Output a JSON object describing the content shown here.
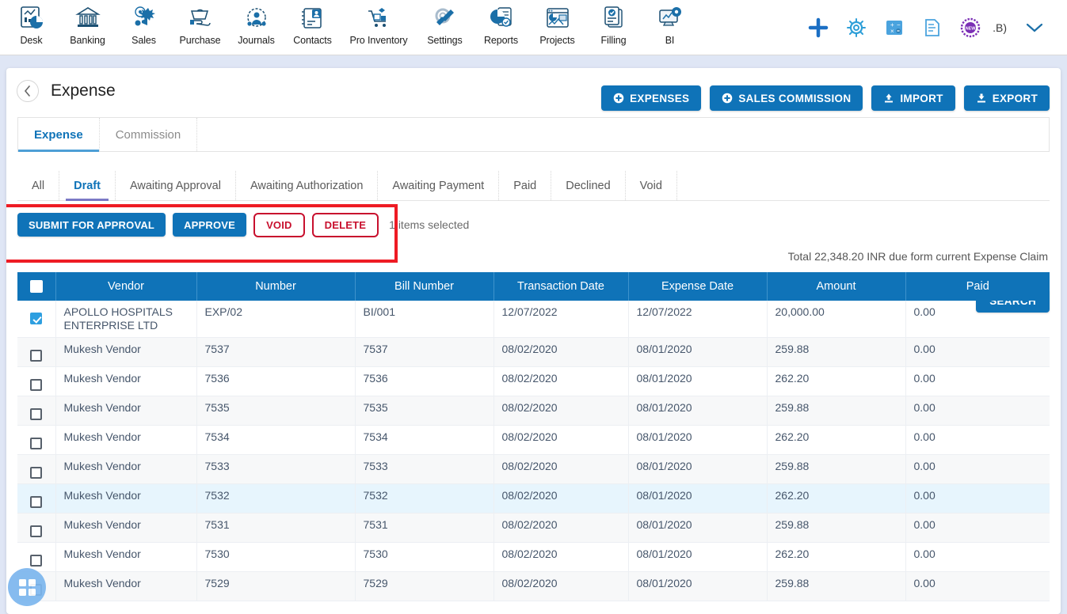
{
  "topnav": {
    "items": [
      {
        "label": "Desk",
        "icon": "desk-dashboard-icon"
      },
      {
        "label": "Banking",
        "icon": "bank-icon"
      },
      {
        "label": "Sales",
        "icon": "sales-icon"
      },
      {
        "label": "Purchase",
        "icon": "purchase-icon"
      },
      {
        "label": "Journals",
        "icon": "journals-icon"
      },
      {
        "label": "Contacts",
        "icon": "contacts-icon"
      },
      {
        "label": "Pro Inventory",
        "icon": "inventory-icon"
      },
      {
        "label": "Settings",
        "icon": "settings-tools-icon"
      },
      {
        "label": "Reports",
        "icon": "reports-piechart-icon"
      },
      {
        "label": "Projects",
        "icon": "projects-icon"
      },
      {
        "label": "Filling",
        "icon": "filling-icon"
      },
      {
        "label": "BI",
        "icon": "bi-monitor-icon"
      }
    ],
    "right_icons": [
      {
        "name": "add-plus-icon",
        "color": "#1b6fc4"
      },
      {
        "name": "gear-icon",
        "color": "#2e9fd8"
      },
      {
        "name": "calculator-icon",
        "color": "#4aa3de"
      },
      {
        "name": "document-icon",
        "color": "#4aa3de"
      },
      {
        "name": "new-badge-icon",
        "color": "#7b2fb5",
        "text": "NEW"
      }
    ],
    "user_code": ".B)",
    "chevron": "chevron-down-icon"
  },
  "header": {
    "back": "back-chevron-icon",
    "title": "Expense",
    "actions": [
      {
        "label": "EXPENSES",
        "icon": "plus-circle-icon"
      },
      {
        "label": "SALES COMMISSION",
        "icon": "plus-circle-icon"
      },
      {
        "label": "IMPORT",
        "icon": "upload-icon"
      },
      {
        "label": "EXPORT",
        "icon": "download-icon"
      }
    ]
  },
  "main_tabs": [
    {
      "label": "Expense",
      "active": true
    },
    {
      "label": "Commission",
      "active": false
    }
  ],
  "filter_tabs": [
    {
      "label": "All",
      "active": false
    },
    {
      "label": "Draft",
      "active": true
    },
    {
      "label": "Awaiting Approval",
      "active": false
    },
    {
      "label": "Awaiting Authorization",
      "active": false
    },
    {
      "label": "Awaiting Payment",
      "active": false
    },
    {
      "label": "Paid",
      "active": false
    },
    {
      "label": "Declined",
      "active": false
    },
    {
      "label": "Void",
      "active": false
    }
  ],
  "actions": {
    "submit_label": "SUBMIT FOR APPROVAL",
    "approve_label": "APPROVE",
    "void_label": "VOID",
    "delete_label": "DELETE",
    "selected_text": "1 items selected",
    "search_label": "SEARCH",
    "total_note": "Total 22,348.20 INR due form current Expense Claim"
  },
  "table": {
    "columns": [
      "",
      "Vendor",
      "Number",
      "Bill Number",
      "Transaction Date",
      "Expense Date",
      "Amount",
      "Paid"
    ],
    "header_checkbox_checked": false,
    "rows": [
      {
        "checked": true,
        "stripe": "plain",
        "vendor": "APOLLO HOSPITALS ENTERPRISE LTD",
        "number": "EXP/02",
        "bill": "BI/001",
        "txn_date": "12/07/2022",
        "exp_date": "12/07/2022",
        "amount": "20,000.00",
        "paid": "0.00"
      },
      {
        "checked": false,
        "stripe": "alt",
        "vendor": "Mukesh Vendor",
        "number": "7537",
        "bill": "7537",
        "txn_date": "08/02/2020",
        "exp_date": "08/01/2020",
        "amount": "259.88",
        "paid": "0.00"
      },
      {
        "checked": false,
        "stripe": "plain",
        "vendor": "Mukesh Vendor",
        "number": "7536",
        "bill": "7536",
        "txn_date": "08/02/2020",
        "exp_date": "08/01/2020",
        "amount": "262.20",
        "paid": "0.00"
      },
      {
        "checked": false,
        "stripe": "alt",
        "vendor": "Mukesh Vendor",
        "number": "7535",
        "bill": "7535",
        "txn_date": "08/02/2020",
        "exp_date": "08/01/2020",
        "amount": "259.88",
        "paid": "0.00"
      },
      {
        "checked": false,
        "stripe": "plain",
        "vendor": "Mukesh Vendor",
        "number": "7534",
        "bill": "7534",
        "txn_date": "08/02/2020",
        "exp_date": "08/01/2020",
        "amount": "262.20",
        "paid": "0.00"
      },
      {
        "checked": false,
        "stripe": "alt",
        "vendor": "Mukesh Vendor",
        "number": "7533",
        "bill": "7533",
        "txn_date": "08/02/2020",
        "exp_date": "08/01/2020",
        "amount": "259.88",
        "paid": "0.00"
      },
      {
        "checked": false,
        "stripe": "hl",
        "vendor": "Mukesh Vendor",
        "number": "7532",
        "bill": "7532",
        "txn_date": "08/02/2020",
        "exp_date": "08/01/2020",
        "amount": "262.20",
        "paid": "0.00"
      },
      {
        "checked": false,
        "stripe": "alt",
        "vendor": "Mukesh Vendor",
        "number": "7531",
        "bill": "7531",
        "txn_date": "08/02/2020",
        "exp_date": "08/01/2020",
        "amount": "259.88",
        "paid": "0.00"
      },
      {
        "checked": false,
        "stripe": "plain",
        "vendor": "Mukesh Vendor",
        "number": "7530",
        "bill": "7530",
        "txn_date": "08/02/2020",
        "exp_date": "08/01/2020",
        "amount": "262.20",
        "paid": "0.00"
      },
      {
        "checked": false,
        "stripe": "alt",
        "vendor": "Mukesh Vendor",
        "number": "7529",
        "bill": "7529",
        "txn_date": "08/02/2020",
        "exp_date": "08/01/2020",
        "amount": "259.88",
        "paid": "0.00"
      }
    ]
  },
  "fab": {
    "icon": "grid-apps-icon"
  },
  "colors": {
    "primary_blue": "#0f73b8",
    "annotation_red": "#ee1b24",
    "danger_red": "#c8102e",
    "page_bg": "#dfe6f5",
    "row_highlight": "#e7f5fd"
  }
}
